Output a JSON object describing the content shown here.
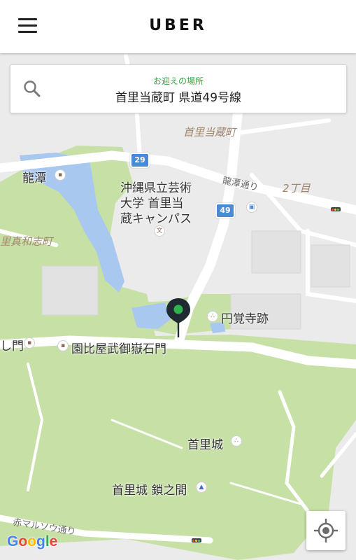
{
  "header": {
    "title": "UBER"
  },
  "search": {
    "caption": "お迎えの場所",
    "address": "首里当蔵町 県道49号線"
  },
  "map": {
    "labels": {
      "ryutan": "龍潭",
      "university_line1": "沖縄県立芸術",
      "university_line2": "大学 首里当",
      "university_line3": "蔵キャンパス",
      "shuri_tonokura": "首里当蔵町",
      "ryutan_dori": "龍潭通り",
      "nichome": "2丁目",
      "shuri_mawashi": "里真和志町",
      "engakuji": "円覚寺跡",
      "sonohyan": "園比屋武御嶽石門",
      "kanmon": "し門",
      "shurijo": "首里城",
      "sasunoma": "首里城 鎖之間",
      "akamaru": "赤マルソウ通り"
    },
    "route_shields": {
      "r29": "29",
      "r49": "49"
    },
    "poi_icons": {
      "school": "文"
    },
    "attribution": "Google"
  },
  "colors": {
    "park": "#c6e0a5",
    "water": "#a8c8f0",
    "road": "#ffffff",
    "pin": "#1f2a33",
    "pin_dot": "#2fb34c",
    "accent_green": "#35a845"
  }
}
